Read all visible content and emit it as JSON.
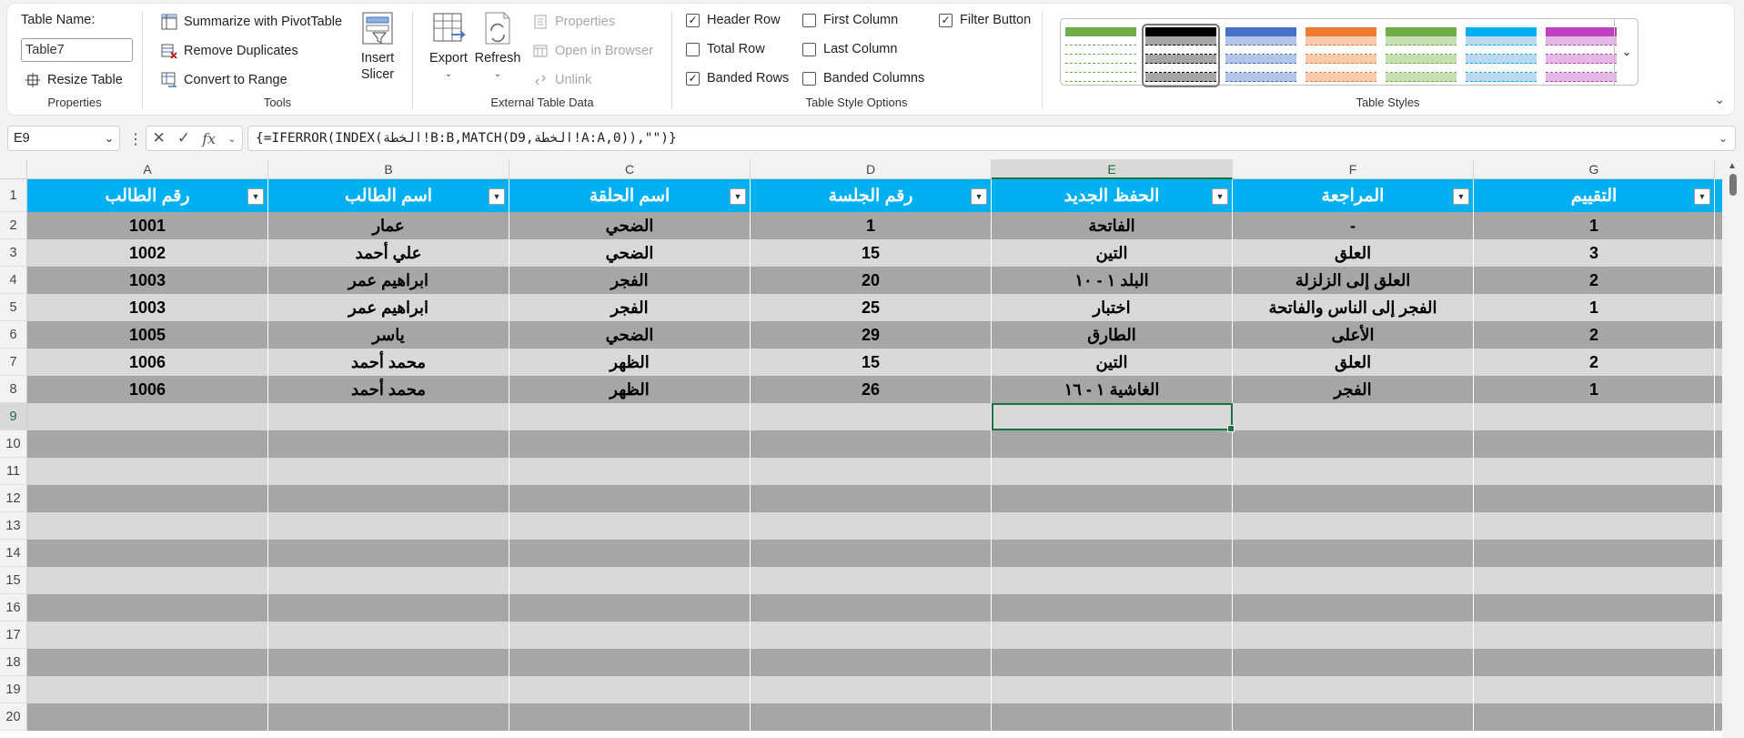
{
  "ribbon": {
    "properties": {
      "table_name_label": "Table Name:",
      "table_name_value": "Table7",
      "resize_label": "Resize Table",
      "group_label": "Properties"
    },
    "tools": {
      "pivot_label": "Summarize with PivotTable",
      "remove_dup_label": "Remove Duplicates",
      "convert_label": "Convert to Range",
      "slicer_label_1": "Insert",
      "slicer_label_2": "Slicer",
      "group_label": "Tools"
    },
    "external": {
      "export_label": "Export",
      "refresh_label": "Refresh",
      "properties_label": "Properties",
      "open_browser_label": "Open in Browser",
      "unlink_label": "Unlink",
      "group_label": "External Table Data"
    },
    "style_options": {
      "header_row": {
        "label": "Header Row",
        "checked": true
      },
      "total_row": {
        "label": "Total Row",
        "checked": false
      },
      "banded_rows": {
        "label": "Banded Rows",
        "checked": true
      },
      "first_column": {
        "label": "First Column",
        "checked": false
      },
      "last_column": {
        "label": "Last Column",
        "checked": false
      },
      "banded_columns": {
        "label": "Banded Columns",
        "checked": false
      },
      "filter_button": {
        "label": "Filter Button",
        "checked": true
      },
      "group_label": "Table Style Options"
    },
    "table_styles": {
      "group_label": "Table Styles",
      "swatches": [
        {
          "name": "green-light",
          "head": "#70ad47",
          "band": "#ffffff",
          "line": "#70ad47"
        },
        {
          "name": "black-selected",
          "head": "#000000",
          "band": "#a6a6a6",
          "line": "#000000"
        },
        {
          "name": "blue",
          "head": "#4472c4",
          "band": "#b4c6e7",
          "line": "#4472c4"
        },
        {
          "name": "orange",
          "head": "#ed7d31",
          "band": "#f8cbad",
          "line": "#ed7d31"
        },
        {
          "name": "green",
          "head": "#70ad47",
          "band": "#c6e0b4",
          "line": "#70ad47"
        },
        {
          "name": "sky",
          "head": "#00b0f0",
          "band": "#bdd7ee",
          "line": "#00b0f0"
        },
        {
          "name": "magenta",
          "head": "#c040c0",
          "band": "#e5b8e5",
          "line": "#c040c0"
        }
      ]
    }
  },
  "formula_bar": {
    "name_box": "E9",
    "formula": "{=IFERROR(INDEX(الخطة!B:B,MATCH(D9,الخطة!A:A,0)),\"\")}"
  },
  "sheet": {
    "columns": [
      "A",
      "B",
      "C",
      "D",
      "E",
      "F",
      "G"
    ],
    "active_column": "E",
    "active_row": "9",
    "row_numbers": [
      "1",
      "2",
      "3",
      "4",
      "5",
      "6",
      "7",
      "8",
      "9",
      "10",
      "11",
      "12",
      "13",
      "14",
      "15",
      "16",
      "17",
      "18",
      "19",
      "20"
    ],
    "headers": [
      "رقم الطالب",
      "اسم الطالب",
      "اسم الحلقة",
      "رقم الجلسة",
      "الحفظ الجديد",
      "المراجعة",
      "التقييم"
    ],
    "rows": [
      [
        "1001",
        "عمار",
        "الضحي",
        "1",
        "الفاتحة",
        "-",
        "1"
      ],
      [
        "1002",
        "علي أحمد",
        "الضحي",
        "15",
        "التين",
        "العلق",
        "3"
      ],
      [
        "1003",
        "ابراهيم عمر",
        "الفجر",
        "20",
        "البلد ١ - ١٠",
        "العلق إلى الزلزلة",
        "2"
      ],
      [
        "1003",
        "ابراهيم عمر",
        "الفجر",
        "25",
        "اختبار",
        "الفجر إلى الناس والفاتحة",
        "1"
      ],
      [
        "1005",
        "ياسر",
        "الضحي",
        "29",
        "الطارق",
        "الأعلى",
        "2"
      ],
      [
        "1006",
        "محمد أحمد",
        "الظهر",
        "15",
        "التين",
        "العلق",
        "2"
      ],
      [
        "1006",
        "محمد أحمد",
        "الظهر",
        "26",
        "الغاشية ١ - ١٦",
        "الفجر",
        "1"
      ]
    ],
    "table_colors": {
      "header": "#00b0f0",
      "band_dark": "#a6a6a6",
      "band_light": "#d9d9d9"
    }
  }
}
